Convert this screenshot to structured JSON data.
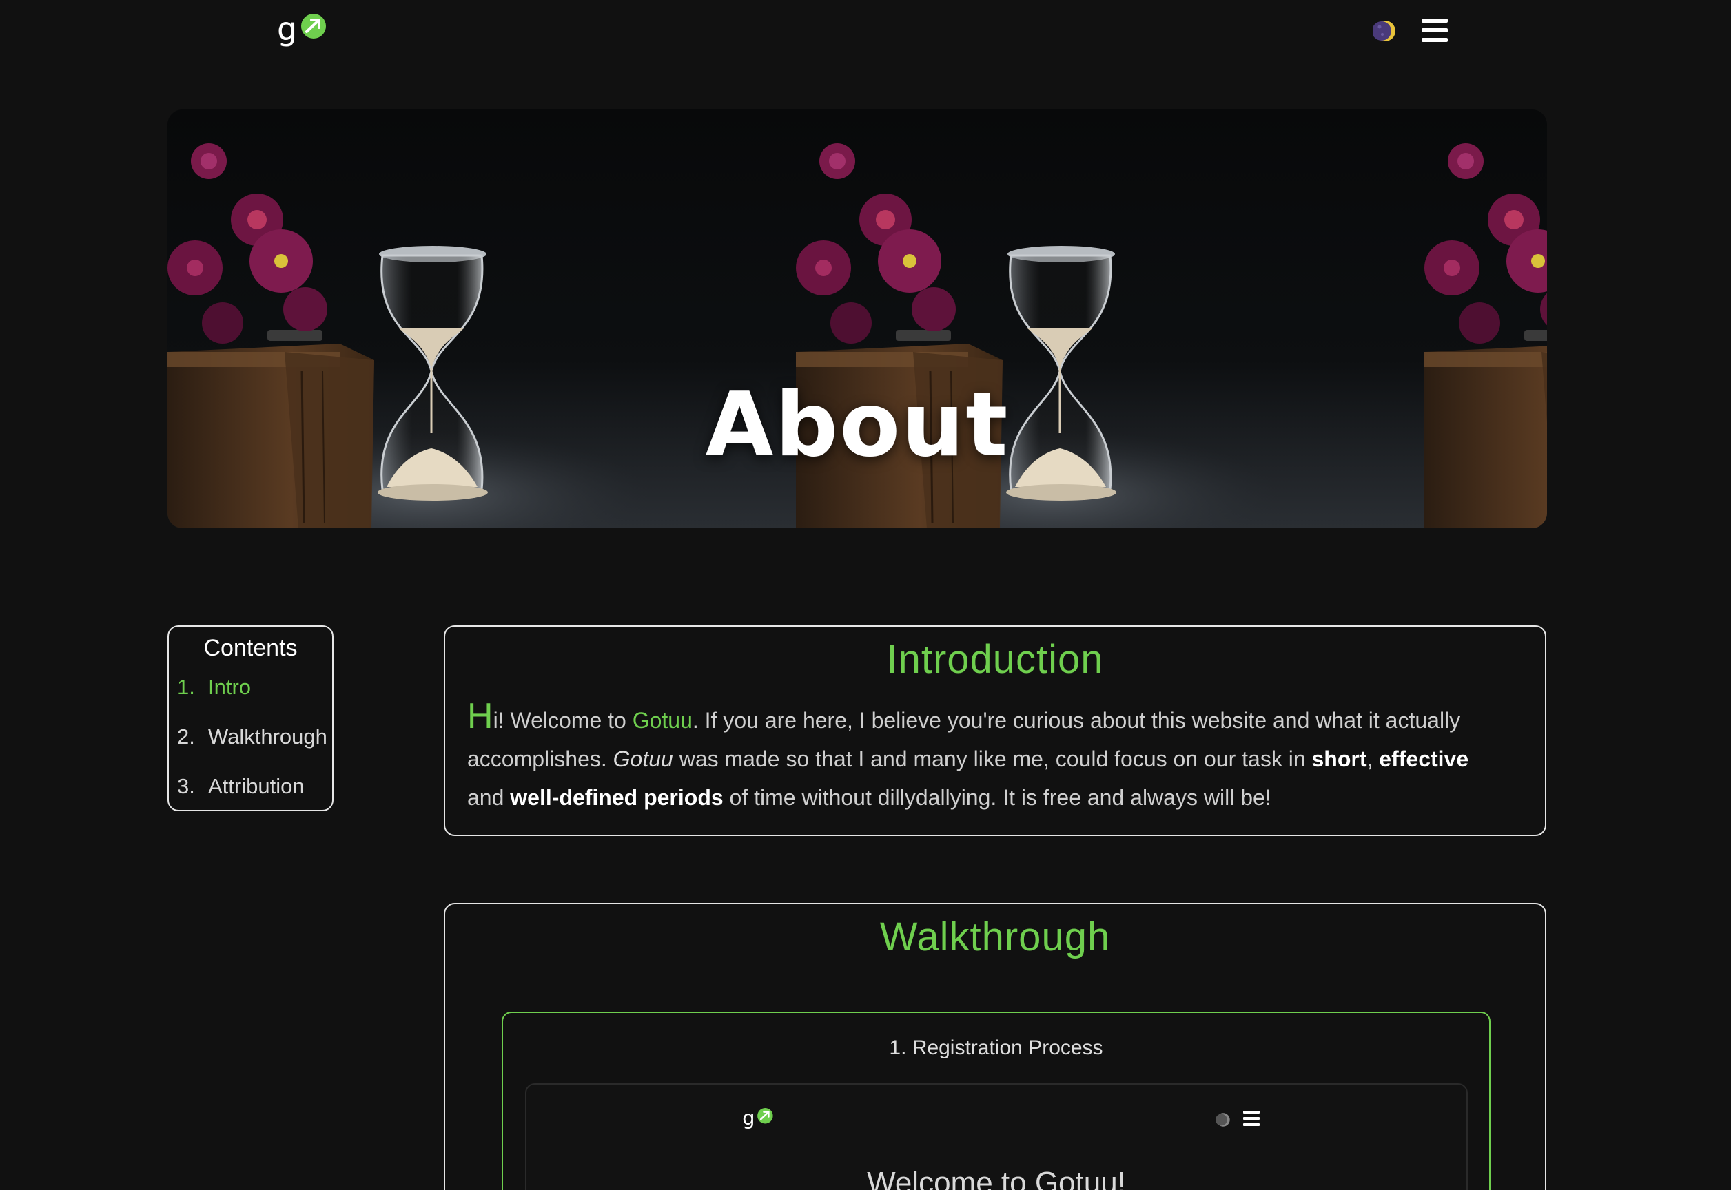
{
  "nav": {
    "logo_icon": "gotuu-logo-icon",
    "theme_toggle_icon": "moon-icon",
    "menu_icon": "hamburger-menu-icon"
  },
  "hero": {
    "title": "About",
    "image": "hourglass-flowers-book-photo"
  },
  "contents": {
    "title": "Contents",
    "items": [
      {
        "num": "1.",
        "label": "Intro",
        "active": true
      },
      {
        "num": "2.",
        "label": "Walkthrough",
        "active": false
      },
      {
        "num": "3.",
        "label": "Attribution",
        "active": false
      }
    ]
  },
  "intro": {
    "title": "Introduction",
    "drop_letter": "H",
    "p1": "i! Welcome to ",
    "brand": "Gotuu",
    "p2": ". If you are here, I believe you're curious about this website and what it actually accomplishes. ",
    "brand_italic": "Gotuu",
    "p3": " was made so that I and many like me, could focus on our task in ",
    "b1": "short",
    "sep1": ", ",
    "b2": "effective",
    "sep2": " and ",
    "b3": "well-defined periods",
    "p4": " of time without dillydallying. It is free and always will be!"
  },
  "walkthrough": {
    "title": "Walkthrough",
    "step1": {
      "title": "1. Registration Process",
      "preview_heading": "Welcome to Gotuu!"
    }
  },
  "colors": {
    "accent": "#6fcf4e",
    "background": "#111111",
    "border": "#e6e6e6"
  }
}
